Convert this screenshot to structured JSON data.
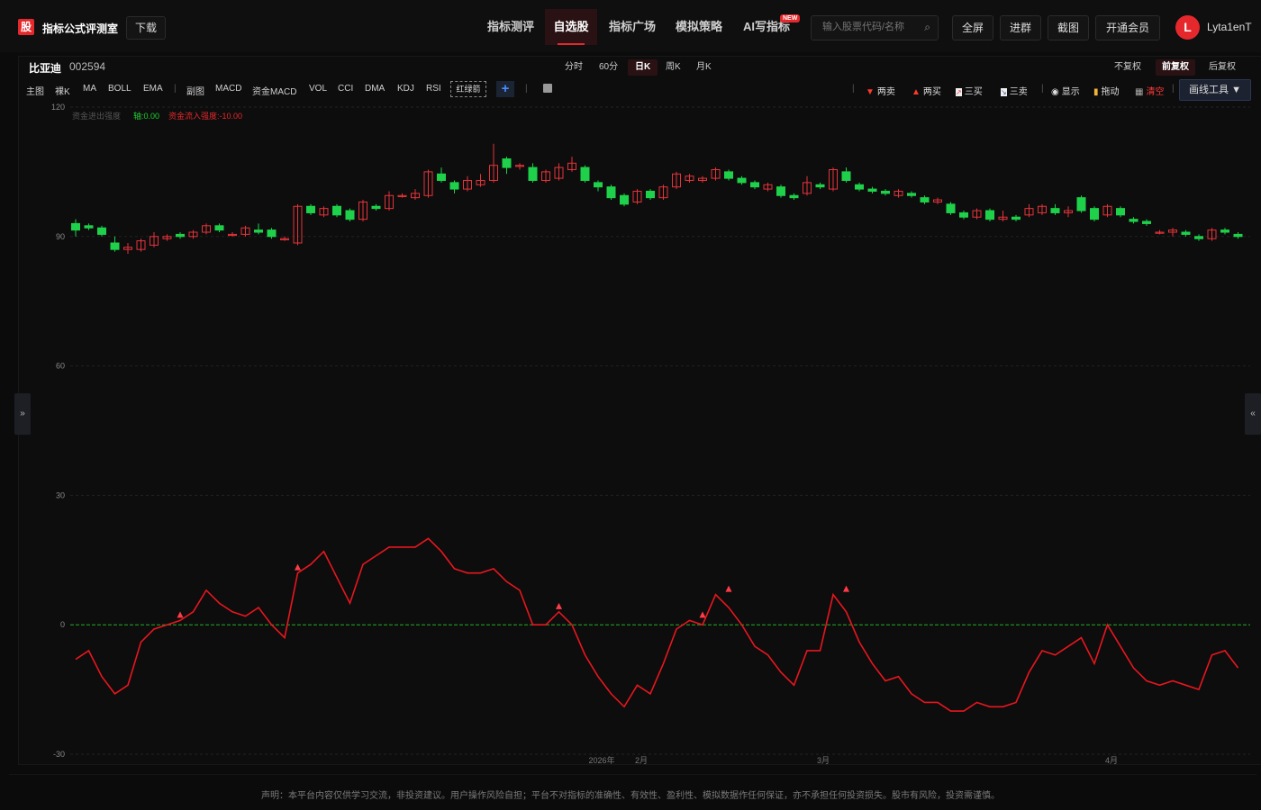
{
  "app": {
    "logo_char": "股",
    "title": "指标公式评测室",
    "download": "下载"
  },
  "nav": [
    {
      "label": "指标测评",
      "active": false
    },
    {
      "label": "自选股",
      "active": true
    },
    {
      "label": "指标广场",
      "active": false
    },
    {
      "label": "模拟策略",
      "active": false
    },
    {
      "label": "AI写指标",
      "active": false
    }
  ],
  "nav_badge": "NEW",
  "search": {
    "placeholder": "输入股票代码/名称"
  },
  "header_buttons": [
    "全屏",
    "进群",
    "截图",
    "开通会员"
  ],
  "user": {
    "initial": "L",
    "name": "Lyta1enT"
  },
  "stock": {
    "name": "比亚迪",
    "code": "002594"
  },
  "periods": [
    {
      "label": "分时",
      "active": false
    },
    {
      "label": "60分",
      "active": false
    },
    {
      "label": "日K",
      "active": true
    },
    {
      "label": "周K",
      "active": false
    },
    {
      "label": "月K",
      "active": false
    }
  ],
  "adjust": [
    {
      "label": "不复权",
      "active": false
    },
    {
      "label": "前复权",
      "active": true
    },
    {
      "label": "后复权",
      "active": false
    }
  ],
  "indicators_main": [
    "主图",
    "裸K",
    "MA",
    "BOLL",
    "EMA"
  ],
  "indicators_sub": [
    "副图",
    "MACD",
    "资金MACD",
    "VOL",
    "CCI",
    "DMA",
    "KDJ",
    "RSI"
  ],
  "indicator_selected": "红绿箭",
  "tools": {
    "two_sell": "两卖",
    "two_buy": "两买",
    "three_buy": "三买",
    "three_sell": "三卖",
    "show": "显示",
    "drag": "拖动",
    "clear": "清空",
    "draw": "画线工具 ▼"
  },
  "side_left": "»",
  "side_right": "«",
  "legend": {
    "name": "资金进出强度",
    "axis_label": "轴:0.00",
    "inflow_label": "资金流入强度:-10.00"
  },
  "colors": {
    "up": "#e5333a",
    "down": "#1fd14a",
    "line": "#e8161e",
    "zero": "#22aa22",
    "accent": "#e5282c"
  },
  "disclaimer": "声明：本平台内容仅供学习交流，非投资建议。用户操作风险自担；平台不对指标的准确性、有效性、盈利性、模拟数据作任何保证，亦不承担任何投资损失。股市有风险，投资需谨慎。",
  "chart_data": {
    "type": "candlestick+line",
    "y_ticks": [
      120,
      90,
      60,
      30,
      0,
      -30
    ],
    "ylim": [
      -30,
      120
    ],
    "x_labels": [
      "2026年",
      "2月",
      "3月",
      "4月"
    ],
    "candles": [
      {
        "o": 93,
        "c": 91.5,
        "h": 94,
        "l": 90
      },
      {
        "o": 92.5,
        "c": 92,
        "h": 93,
        "l": 91.5
      },
      {
        "o": 92,
        "c": 90.5,
        "h": 92.5,
        "l": 90
      },
      {
        "o": 88.5,
        "c": 87,
        "h": 90,
        "l": 86.5
      },
      {
        "o": 87,
        "c": 87.5,
        "h": 88.5,
        "l": 86
      },
      {
        "o": 87,
        "c": 89,
        "h": 89.5,
        "l": 86.5
      },
      {
        "o": 88,
        "c": 90,
        "h": 91,
        "l": 87.5
      },
      {
        "o": 89.5,
        "c": 90,
        "h": 90.5,
        "l": 89
      },
      {
        "o": 90.5,
        "c": 90,
        "h": 91,
        "l": 89.5
      },
      {
        "o": 90,
        "c": 91,
        "h": 91.5,
        "l": 89.5
      },
      {
        "o": 91,
        "c": 92.5,
        "h": 93,
        "l": 90.5
      },
      {
        "o": 92.5,
        "c": 91.5,
        "h": 93,
        "l": 91
      },
      {
        "o": 90.5,
        "c": 90.5,
        "h": 91,
        "l": 90
      },
      {
        "o": 90.5,
        "c": 92,
        "h": 92.5,
        "l": 90
      },
      {
        "o": 91.5,
        "c": 91,
        "h": 93,
        "l": 90.5
      },
      {
        "o": 91.5,
        "c": 90,
        "h": 92,
        "l": 89.5
      },
      {
        "o": 89.5,
        "c": 89.5,
        "h": 90,
        "l": 89
      },
      {
        "o": 88.5,
        "c": 97,
        "h": 97.5,
        "l": 88
      },
      {
        "o": 97,
        "c": 95.5,
        "h": 97.5,
        "l": 95
      },
      {
        "o": 95,
        "c": 96.5,
        "h": 97,
        "l": 94.5
      },
      {
        "o": 97,
        "c": 95,
        "h": 97.5,
        "l": 94.5
      },
      {
        "o": 96,
        "c": 94,
        "h": 96.5,
        "l": 93.5
      },
      {
        "o": 94,
        "c": 98,
        "h": 98.5,
        "l": 93.5
      },
      {
        "o": 97,
        "c": 96.5,
        "h": 97.5,
        "l": 96
      },
      {
        "o": 96.5,
        "c": 99.5,
        "h": 100.5,
        "l": 96
      },
      {
        "o": 99.5,
        "c": 99.5,
        "h": 100,
        "l": 99
      },
      {
        "o": 99,
        "c": 100,
        "h": 101,
        "l": 98.5
      },
      {
        "o": 99.5,
        "c": 105,
        "h": 105.5,
        "l": 99
      },
      {
        "o": 104.5,
        "c": 103,
        "h": 106,
        "l": 102.5
      },
      {
        "o": 102.5,
        "c": 101,
        "h": 103,
        "l": 100
      },
      {
        "o": 101,
        "c": 103,
        "h": 104,
        "l": 100.5
      },
      {
        "o": 102,
        "c": 103,
        "h": 104.5,
        "l": 101.5
      },
      {
        "o": 103,
        "c": 106.5,
        "h": 111.5,
        "l": 102.5
      },
      {
        "o": 108,
        "c": 106,
        "h": 108.5,
        "l": 104.5
      },
      {
        "o": 106.5,
        "c": 106.5,
        "h": 107,
        "l": 105.5
      },
      {
        "o": 106,
        "c": 103,
        "h": 107,
        "l": 102.5
      },
      {
        "o": 103,
        "c": 105,
        "h": 105.5,
        "l": 102.5
      },
      {
        "o": 103.5,
        "c": 106,
        "h": 107,
        "l": 103
      },
      {
        "o": 105.5,
        "c": 107,
        "h": 108.5,
        "l": 105
      },
      {
        "o": 106,
        "c": 103,
        "h": 106.5,
        "l": 102.5
      },
      {
        "o": 102.5,
        "c": 101.5,
        "h": 103,
        "l": 100.5
      },
      {
        "o": 101.5,
        "c": 99,
        "h": 102,
        "l": 98.5
      },
      {
        "o": 99.5,
        "c": 97.5,
        "h": 100,
        "l": 97
      },
      {
        "o": 98,
        "c": 100.5,
        "h": 101,
        "l": 97.5
      },
      {
        "o": 100.5,
        "c": 99,
        "h": 101,
        "l": 98.5
      },
      {
        "o": 99,
        "c": 101.5,
        "h": 102,
        "l": 98.5
      },
      {
        "o": 101.5,
        "c": 104.5,
        "h": 105,
        "l": 101
      },
      {
        "o": 103,
        "c": 104,
        "h": 104.5,
        "l": 102.5
      },
      {
        "o": 103,
        "c": 103.5,
        "h": 104,
        "l": 102.5
      },
      {
        "o": 103.5,
        "c": 105.5,
        "h": 106,
        "l": 103
      },
      {
        "o": 105,
        "c": 103.5,
        "h": 105.5,
        "l": 103
      },
      {
        "o": 103.5,
        "c": 102.5,
        "h": 104,
        "l": 102
      },
      {
        "o": 102.5,
        "c": 101.5,
        "h": 103,
        "l": 101
      },
      {
        "o": 101,
        "c": 102,
        "h": 102.5,
        "l": 100.5
      },
      {
        "o": 101.5,
        "c": 99.5,
        "h": 102,
        "l": 99
      },
      {
        "o": 99.5,
        "c": 99,
        "h": 100,
        "l": 98.5
      },
      {
        "o": 100,
        "c": 102.5,
        "h": 104,
        "l": 99.5
      },
      {
        "o": 102,
        "c": 101.5,
        "h": 102.5,
        "l": 101
      },
      {
        "o": 101,
        "c": 105.5,
        "h": 106,
        "l": 100.5
      },
      {
        "o": 105,
        "c": 103,
        "h": 106,
        "l": 102.5
      },
      {
        "o": 102,
        "c": 101,
        "h": 102.5,
        "l": 100.5
      },
      {
        "o": 101,
        "c": 100.5,
        "h": 101.5,
        "l": 100
      },
      {
        "o": 100.5,
        "c": 100,
        "h": 101,
        "l": 99.5
      },
      {
        "o": 99.5,
        "c": 100.5,
        "h": 101,
        "l": 99
      },
      {
        "o": 100,
        "c": 99.5,
        "h": 100.5,
        "l": 99
      },
      {
        "o": 99,
        "c": 98,
        "h": 99.5,
        "l": 97.5
      },
      {
        "o": 98,
        "c": 98.5,
        "h": 99,
        "l": 97.5
      },
      {
        "o": 97.5,
        "c": 95.5,
        "h": 98,
        "l": 95
      },
      {
        "o": 95.5,
        "c": 94.5,
        "h": 96,
        "l": 94
      },
      {
        "o": 94.5,
        "c": 96,
        "h": 96.5,
        "l": 94
      },
      {
        "o": 96,
        "c": 94,
        "h": 96.5,
        "l": 93.5
      },
      {
        "o": 94,
        "c": 94.5,
        "h": 96,
        "l": 93.5
      },
      {
        "o": 94.5,
        "c": 94,
        "h": 95,
        "l": 93.5
      },
      {
        "o": 95,
        "c": 96.5,
        "h": 97.5,
        "l": 94.5
      },
      {
        "o": 95.5,
        "c": 97,
        "h": 97.5,
        "l": 95
      },
      {
        "o": 96.5,
        "c": 95.5,
        "h": 97.5,
        "l": 95
      },
      {
        "o": 95.5,
        "c": 96,
        "h": 97,
        "l": 94.5
      },
      {
        "o": 99,
        "c": 96,
        "h": 99.5,
        "l": 95.5
      },
      {
        "o": 96.5,
        "c": 94,
        "h": 97,
        "l": 93.5
      },
      {
        "o": 95,
        "c": 97,
        "h": 97.5,
        "l": 94.5
      },
      {
        "o": 96.5,
        "c": 95,
        "h": 97,
        "l": 94.5
      },
      {
        "o": 94,
        "c": 93.5,
        "h": 94.5,
        "l": 93
      },
      {
        "o": 93.5,
        "c": 93,
        "h": 94,
        "l": 92.5
      },
      {
        "o": 91,
        "c": 91,
        "h": 91.5,
        "l": 90.5
      },
      {
        "o": 91,
        "c": 91.5,
        "h": 92,
        "l": 90
      },
      {
        "o": 91,
        "c": 90.5,
        "h": 91.5,
        "l": 90
      },
      {
        "o": 90,
        "c": 89.5,
        "h": 90.5,
        "l": 89
      },
      {
        "o": 89.5,
        "c": 91.5,
        "h": 92,
        "l": 89
      },
      {
        "o": 91.5,
        "c": 91,
        "h": 92,
        "l": 90.5
      },
      {
        "o": 90.5,
        "c": 90,
        "h": 91,
        "l": 89.5
      }
    ],
    "series": [
      {
        "name": "资金进出强度",
        "values": [
          -8,
          -6,
          -12,
          -16,
          -14,
          -4,
          -1,
          0,
          1,
          3,
          8,
          5,
          3,
          2,
          4,
          0,
          -3,
          12,
          14,
          17,
          11,
          5,
          14,
          16,
          18,
          18,
          18,
          20,
          17,
          13,
          12,
          12,
          13,
          10,
          8,
          0,
          0,
          3,
          0,
          -7,
          -12,
          -16,
          -19,
          -14,
          -16,
          -9,
          -1,
          1,
          0,
          7,
          4,
          0,
          -5,
          -7,
          -11,
          -14,
          -6,
          -6,
          7,
          3,
          -4,
          -9,
          -13,
          -12,
          -16,
          -18,
          -18,
          -20,
          -20,
          -18,
          -19,
          -19,
          -18,
          -11,
          -6,
          -7,
          -5,
          -3,
          -9,
          0,
          -5,
          -10,
          -13,
          -14,
          -13,
          -14,
          -15,
          -7,
          -6,
          -10
        ]
      }
    ],
    "markers": [
      {
        "type": "两买",
        "index": 8,
        "value": 1
      },
      {
        "type": "两买",
        "index": 17,
        "value": 12
      },
      {
        "type": "两买",
        "index": 37,
        "value": 3
      },
      {
        "type": "两买",
        "index": 48,
        "value": 1
      },
      {
        "type": "两买",
        "index": 50,
        "value": 7
      },
      {
        "type": "两买",
        "index": 59,
        "value": 7
      }
    ]
  }
}
